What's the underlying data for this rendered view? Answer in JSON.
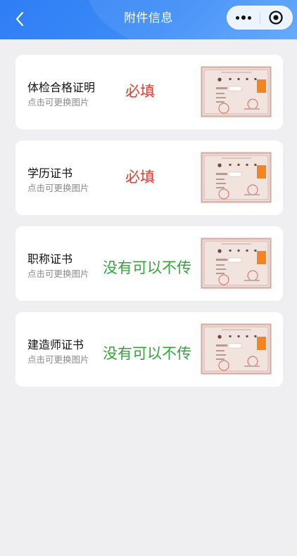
{
  "nav": {
    "title": "附件信息",
    "back_icon": "chevron-left-icon",
    "more_icon": "more-dots-icon",
    "close_icon": "target-close-icon",
    "color": "#3a86f6"
  },
  "cards": [
    {
      "name": "体检合格证明",
      "hint": "点击可更换图片",
      "tag": "必填",
      "tag_type": "required"
    },
    {
      "name": "学历证书",
      "hint": "点击可更换图片",
      "tag": "必填",
      "tag_type": "required"
    },
    {
      "name": "职称证书",
      "hint": "点击可更换图片",
      "tag": "没有可以不传",
      "tag_type": "optional"
    },
    {
      "name": "建造师证书",
      "hint": "点击可更换图片",
      "tag": "没有可以不传",
      "tag_type": "optional"
    }
  ],
  "colors": {
    "required": "#e23a2e",
    "optional": "#2fa53a",
    "background": "#efeff1"
  }
}
